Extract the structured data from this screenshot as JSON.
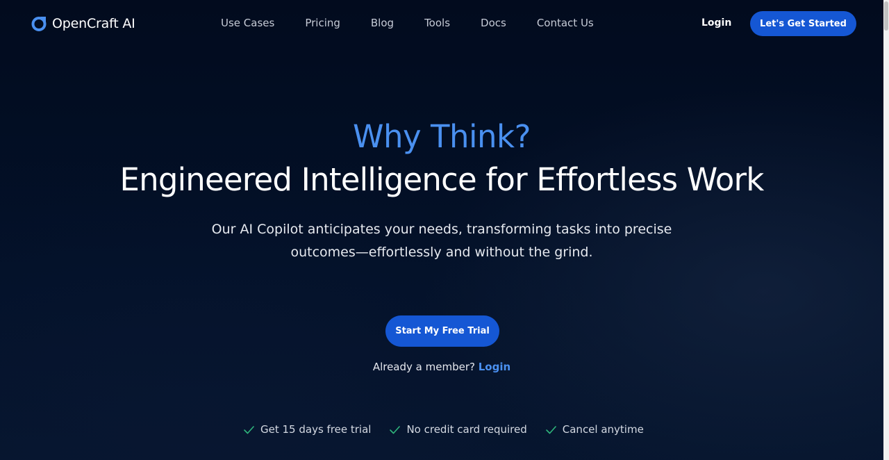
{
  "brand": {
    "name": "OpenCraft AI",
    "accent_color": "#4a90f0",
    "primary_button_color": "#1557d4",
    "logo_icon": "opencraft-logo-icon"
  },
  "nav": {
    "items": [
      {
        "label": "Use Cases"
      },
      {
        "label": "Pricing"
      },
      {
        "label": "Blog"
      },
      {
        "label": "Tools"
      },
      {
        "label": "Docs"
      },
      {
        "label": "Contact Us"
      }
    ],
    "login_label": "Login",
    "cta_label": "Let's Get Started"
  },
  "hero": {
    "eyebrow": "Why Think?",
    "title": "Engineered Intelligence for Effortless Work",
    "subtitle": "Our AI Copilot anticipates your needs, transforming tasks into precise outcomes—effortlessly and without the grind.",
    "trial_button_label": "Start My Free Trial",
    "member_prompt": "Already a member?",
    "member_login_label": "Login"
  },
  "features": {
    "icon": "check-icon",
    "check_color": "#2fb67c",
    "items": [
      {
        "label": "Get 15 days free trial"
      },
      {
        "label": "No credit card required"
      },
      {
        "label": "Cancel anytime"
      }
    ]
  }
}
